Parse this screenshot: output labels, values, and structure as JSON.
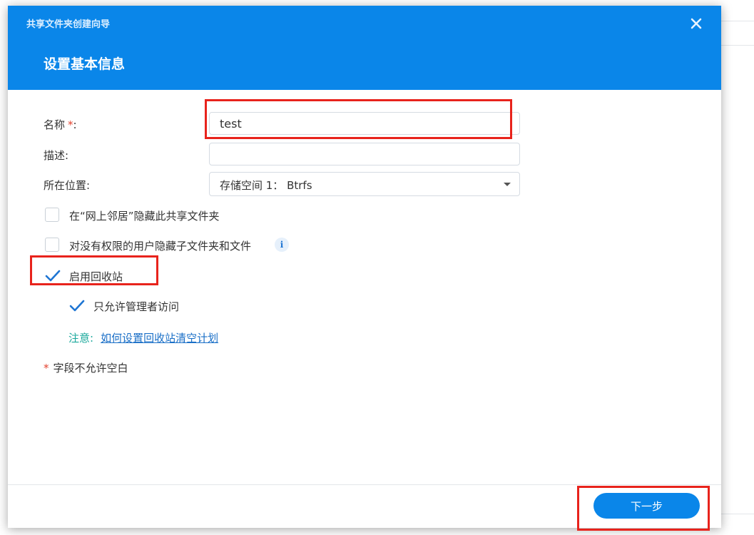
{
  "wizard": {
    "title": "共享文件夹创建向导",
    "step_title": "设置基本信息"
  },
  "form": {
    "name": {
      "label": "名称",
      "required_mark": "*",
      "suffix": ":",
      "value": "test"
    },
    "description": {
      "label": "描述:",
      "value": ""
    },
    "location": {
      "label": "所在位置:",
      "value": "存储空间 1： Btrfs"
    }
  },
  "options": {
    "hide_network": {
      "label": "在“网上邻居”隐藏此共享文件夹",
      "checked": false
    },
    "hide_subfolders": {
      "label": "对没有权限的用户隐藏子文件夹和文件",
      "checked": false,
      "icon": "info-icon"
    },
    "recycle_bin": {
      "label": "启用回收站",
      "checked": true
    },
    "admin_only": {
      "label": "只允许管理者访问",
      "checked": true
    }
  },
  "note": {
    "label": "注意:",
    "link": "如何设置回收站清空计划"
  },
  "required_note": {
    "star": "*",
    "text": "字段不允许空白"
  },
  "footer": {
    "next_label": "下一步"
  },
  "colors": {
    "accent": "#0a86e9",
    "highlight": "#e8231c",
    "check": "#1e75d3",
    "note": "#19a89b",
    "link": "#1a6fc7"
  }
}
